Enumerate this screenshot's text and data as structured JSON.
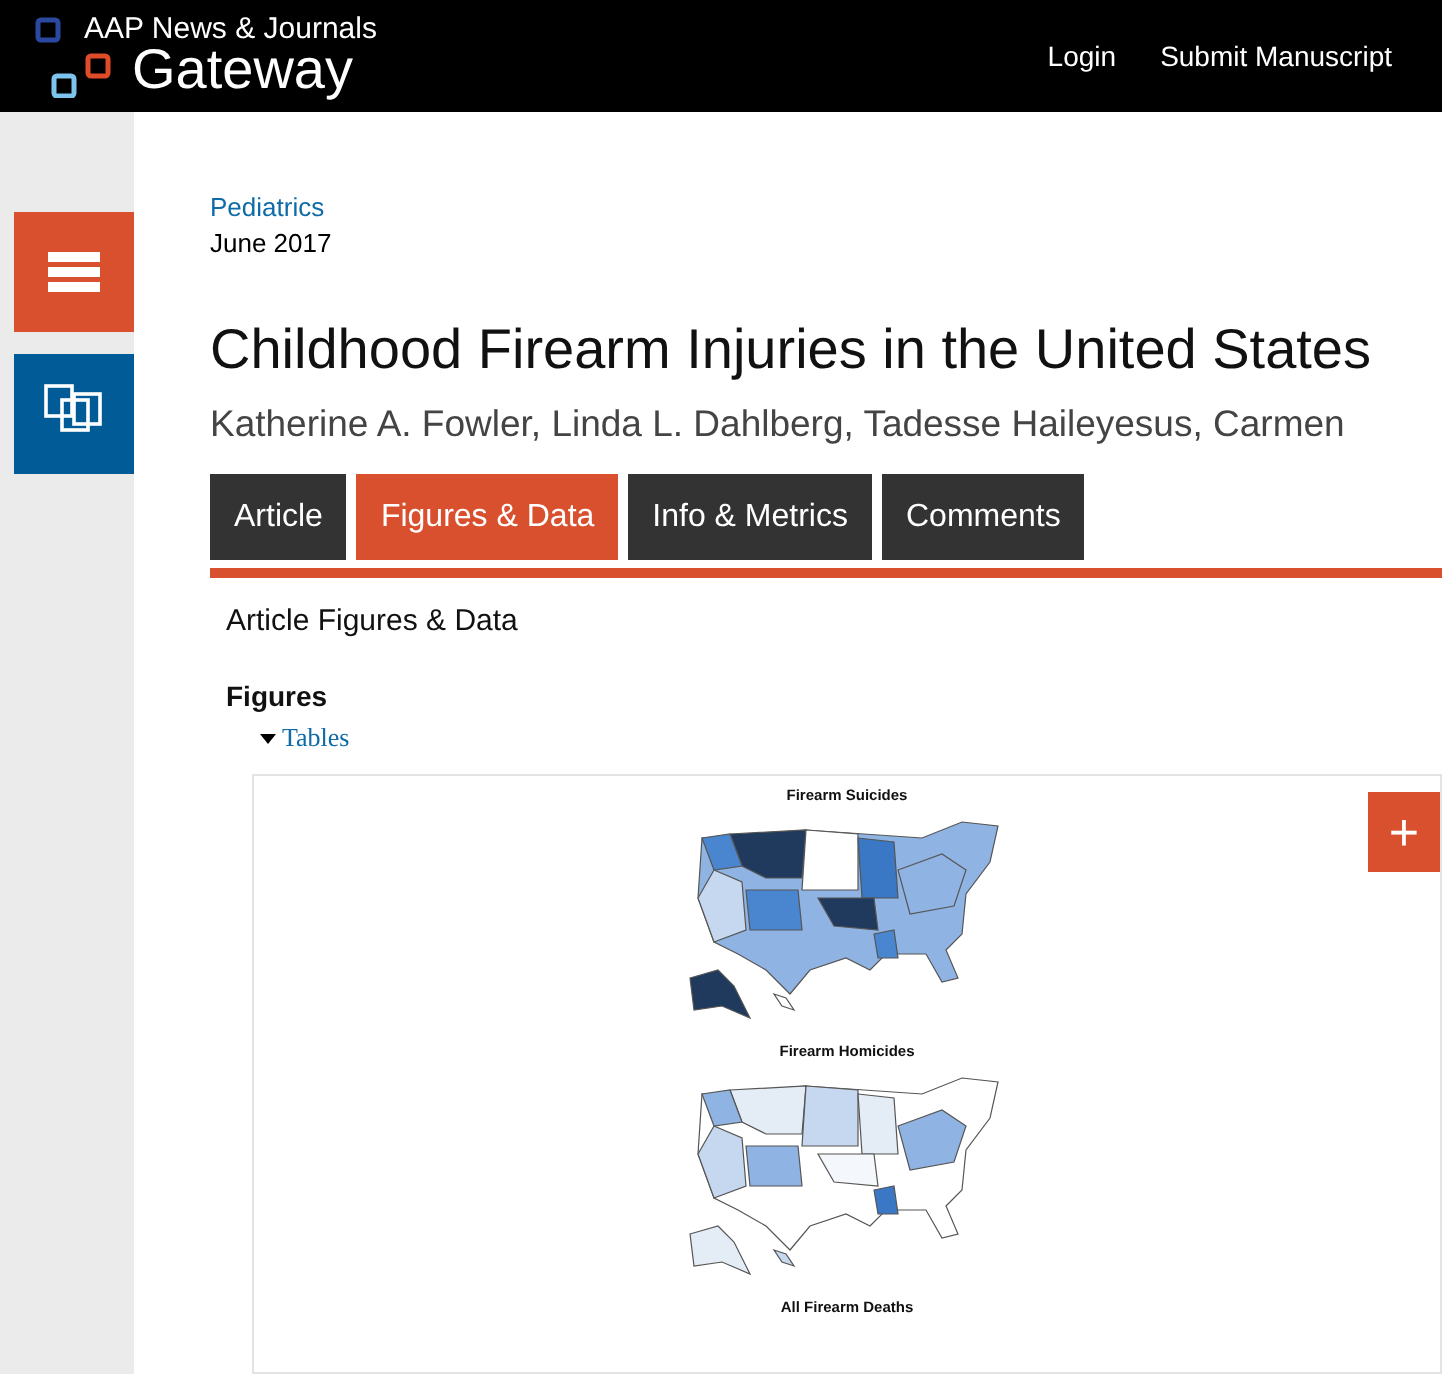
{
  "header": {
    "logo_line_1": "AAP News & Journals",
    "logo_line_2": "Gateway",
    "nav": [
      "Login",
      "Submit Manuscript"
    ]
  },
  "journal": "Pediatrics",
  "date": "June 2017",
  "title": "Childhood Firearm Injuries in the United States",
  "authors": "Katherine A. Fowler, Linda L. Dahlberg, Tadesse Haileyesus, Carmen",
  "tabs": [
    {
      "label": "Article",
      "selected": false
    },
    {
      "label": "Figures & Data",
      "selected": true
    },
    {
      "label": "Info & Metrics",
      "selected": false
    },
    {
      "label": "Comments",
      "selected": false
    }
  ],
  "section_title": "Article Figures & Data",
  "figures_heading": "Figures",
  "tables_link": {
    "label": "Tables",
    "expanded": true
  },
  "figure": {
    "expand_button": "+",
    "panels": [
      {
        "title": "Firearm Suicides",
        "kind": "map"
      },
      {
        "title": "Firearm Homicides",
        "kind": "map"
      },
      {
        "title": "All Firearm Deaths",
        "kind": "title"
      }
    ]
  }
}
